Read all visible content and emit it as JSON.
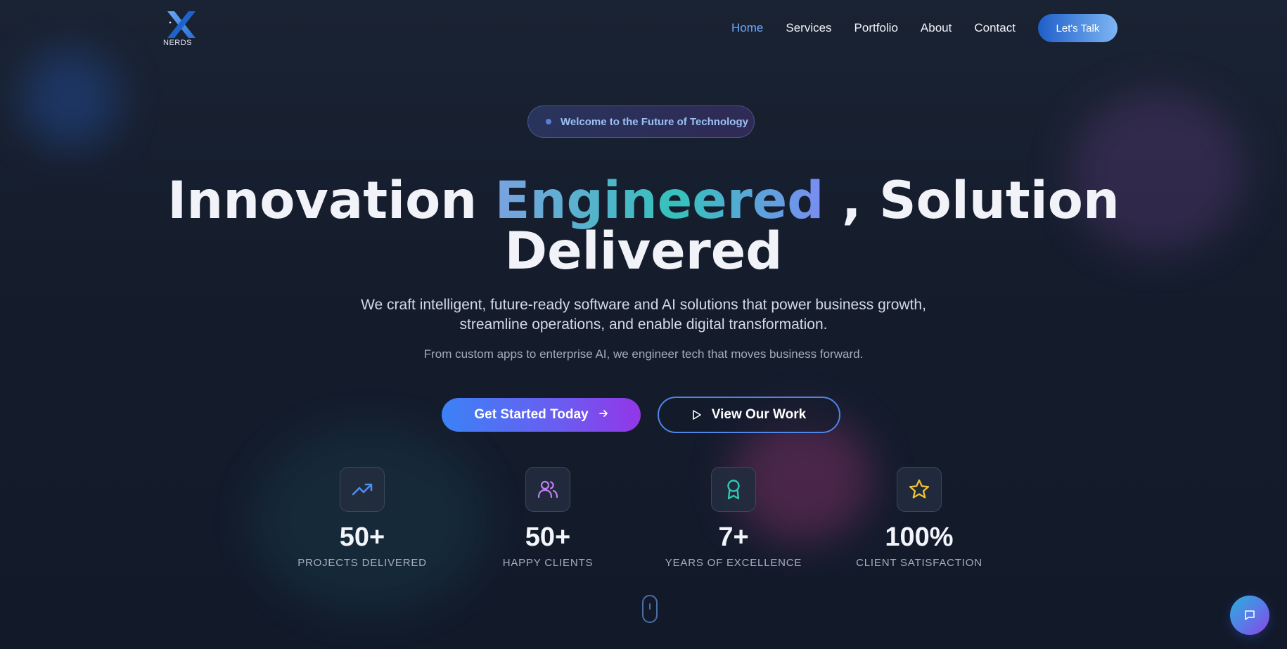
{
  "brand": {
    "logo_text": "NERDS"
  },
  "nav": {
    "items": [
      {
        "label": "Home",
        "active": true
      },
      {
        "label": "Services",
        "active": false
      },
      {
        "label": "Portfolio",
        "active": false
      },
      {
        "label": "About",
        "active": false
      },
      {
        "label": "Contact",
        "active": false
      }
    ],
    "cta_label": "Let's Talk"
  },
  "hero": {
    "pill_text": "Welcome to the Future of Technology",
    "headline_part1": "Innovation ",
    "headline_highlight": "Engineered",
    "headline_part2": " , Solution",
    "headline_line2": "Delivered",
    "subtitle_line1": "We craft intelligent, future-ready software and AI solutions that power business growth,",
    "subtitle_line2": "streamline operations, and enable digital transformation.",
    "tagline": "From custom apps to enterprise AI, we engineer tech that moves business forward.",
    "primary_button": "Get Started Today",
    "secondary_button": "View Our Work"
  },
  "stats": [
    {
      "icon": "trending-up-icon",
      "value": "50+",
      "label": "PROJECTS DELIVERED"
    },
    {
      "icon": "users-icon",
      "value": "50+",
      "label": "HAPPY CLIENTS"
    },
    {
      "icon": "award-icon",
      "value": "7+",
      "label": "YEARS OF EXCELLENCE"
    },
    {
      "icon": "star-icon",
      "value": "100%",
      "label": "CLIENT SATISFACTION"
    }
  ],
  "colors": {
    "accent_blue": "#3b82f6",
    "accent_purple": "#9336e8",
    "active_nav": "#6ea8ff",
    "background": "#141b2b"
  }
}
